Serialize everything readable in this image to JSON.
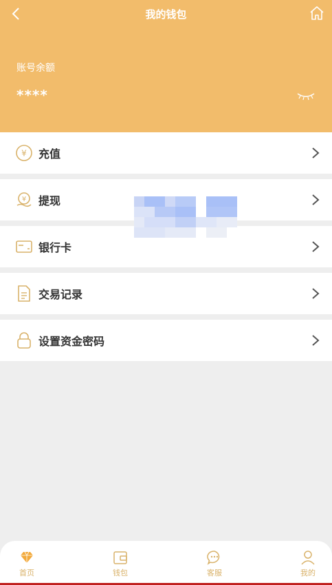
{
  "header": {
    "title": "我的钱包",
    "balance_label": "账号余额",
    "balance_value": "****"
  },
  "menu": [
    {
      "label": "充值",
      "icon": "yuan-coin-icon"
    },
    {
      "label": "提现",
      "icon": "hand-coin-icon"
    },
    {
      "label": "银行卡",
      "icon": "bank-card-icon"
    },
    {
      "label": "交易记录",
      "icon": "document-icon"
    },
    {
      "label": "设置资金密码",
      "icon": "lock-icon"
    }
  ],
  "tabbar": [
    {
      "label": "首页",
      "icon": "diamond-icon"
    },
    {
      "label": "钱包",
      "icon": "wallet-icon"
    },
    {
      "label": "客服",
      "icon": "chat-icon"
    },
    {
      "label": "我的",
      "icon": "person-icon"
    }
  ],
  "colors": {
    "header_bg": "#f2bc6b",
    "icon_gold": "#d9b26a",
    "tab_active": "#f2a93b"
  }
}
